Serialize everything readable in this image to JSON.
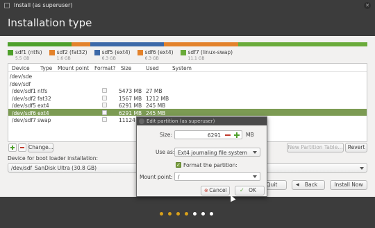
{
  "window": {
    "title": "Install (as superuser)"
  },
  "header": {
    "title": "Installation type"
  },
  "partbar": {
    "segments": [
      {
        "color": "#4ea02b",
        "fraction": 0.177
      },
      {
        "color": "#e3822b",
        "fraction": 0.052
      },
      {
        "color": "#3c69a8",
        "fraction": 0.206
      },
      {
        "color": "#e3822b",
        "fraction": 0.206
      },
      {
        "color": "#6aab3a",
        "fraction": 0.359
      }
    ]
  },
  "legend": [
    {
      "name": "sdf1 (ntfs)",
      "size": "5.5 GB",
      "color": "#4ea02b"
    },
    {
      "name": "sdf2 (fat32)",
      "size": "1.6 GB",
      "color": "#e3822b"
    },
    {
      "name": "sdf5 (ext4)",
      "size": "6.3 GB",
      "color": "#3c69a8"
    },
    {
      "name": "sdf6 (ext4)",
      "size": "6.3 GB",
      "color": "#e3822b"
    },
    {
      "name": "sdf7 (linux-swap)",
      "size": "11.1 GB",
      "color": "#6aab3a"
    }
  ],
  "table": {
    "headers": {
      "device": "Device",
      "type": "Type",
      "mount": "Mount point",
      "format": "Format?",
      "size": "Size",
      "used": "Used",
      "system": "System"
    },
    "rows": [
      {
        "device": "/dev/sde",
        "type": "",
        "size": "",
        "used": ""
      },
      {
        "device": "/dev/sdf",
        "type": "",
        "size": "",
        "used": ""
      },
      {
        "device": "/dev/sdf1",
        "type": "ntfs",
        "size": "5473 MB",
        "used": "27 MB"
      },
      {
        "device": "/dev/sdf2",
        "type": "fat32",
        "size": "1567 MB",
        "used": "1212 MB"
      },
      {
        "device": "/dev/sdf5",
        "type": "ext4",
        "size": "6291 MB",
        "used": "245 MB"
      },
      {
        "device": "/dev/sdf6",
        "type": "ext4",
        "size": "6291 MB",
        "used": "245 MB"
      },
      {
        "device": "/dev/sdf7",
        "type": "swap",
        "size": "11124 M",
        "used": ""
      }
    ]
  },
  "table_buttons": {
    "change": "Change...",
    "new_partition_table": "New Partition Table...",
    "revert": "Revert"
  },
  "bootloader": {
    "label": "Device for boot loader installation:",
    "device": "/dev/sdf",
    "description": "SanDisk Ultra (30.8 GB)"
  },
  "nav": {
    "quit": "Quit",
    "back": "Back",
    "install": "Install Now"
  },
  "dialog": {
    "title": "Edit partition (as superuser)",
    "size_label": "Size:",
    "size_value": "6291",
    "size_unit": "MB",
    "use_as_label": "Use as:",
    "use_as_value": "Ext4 journaling file system",
    "format_label": "Format the partition:",
    "mount_label": "Mount point:",
    "mount_value": "/",
    "cancel": "Cancel",
    "ok": "OK"
  },
  "progress_dots": [
    "#d8a11b",
    "#d8a11b",
    "#d8a11b",
    "#d8a11b",
    "#ffffff",
    "#ffffff",
    "#ffffff"
  ]
}
